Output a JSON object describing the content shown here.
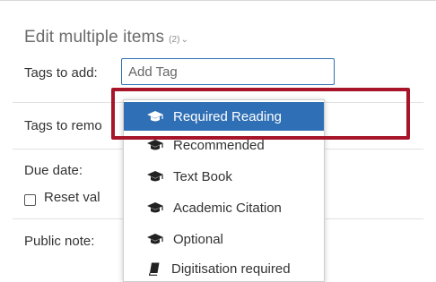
{
  "dialog": {
    "title": "Edit multiple items",
    "count": "(2)",
    "tags_to_add_label": "Tags to add:",
    "tags_to_remove_label": "Tags to remo",
    "due_date_label": "Due date:",
    "reset_label": "Reset val",
    "public_note_label": "Public note:"
  },
  "tag_input": {
    "placeholder": "Add Tag"
  },
  "dropdown": {
    "items": [
      {
        "label": "Required Reading",
        "icon": "graduation-cap-icon",
        "selected": true
      },
      {
        "label": "Recommended",
        "icon": "graduation-cap-icon"
      },
      {
        "label": "Text Book",
        "icon": "graduation-cap-icon"
      },
      {
        "label": "Academic Citation",
        "icon": "graduation-cap-icon"
      },
      {
        "label": "Optional",
        "icon": "graduation-cap-icon"
      },
      {
        "label": "Digitisation required",
        "icon": "book-icon"
      }
    ]
  },
  "colors": {
    "selected_bg": "#2f6fb5",
    "highlight_border": "#a8152a",
    "input_border": "#2f6fb5"
  }
}
